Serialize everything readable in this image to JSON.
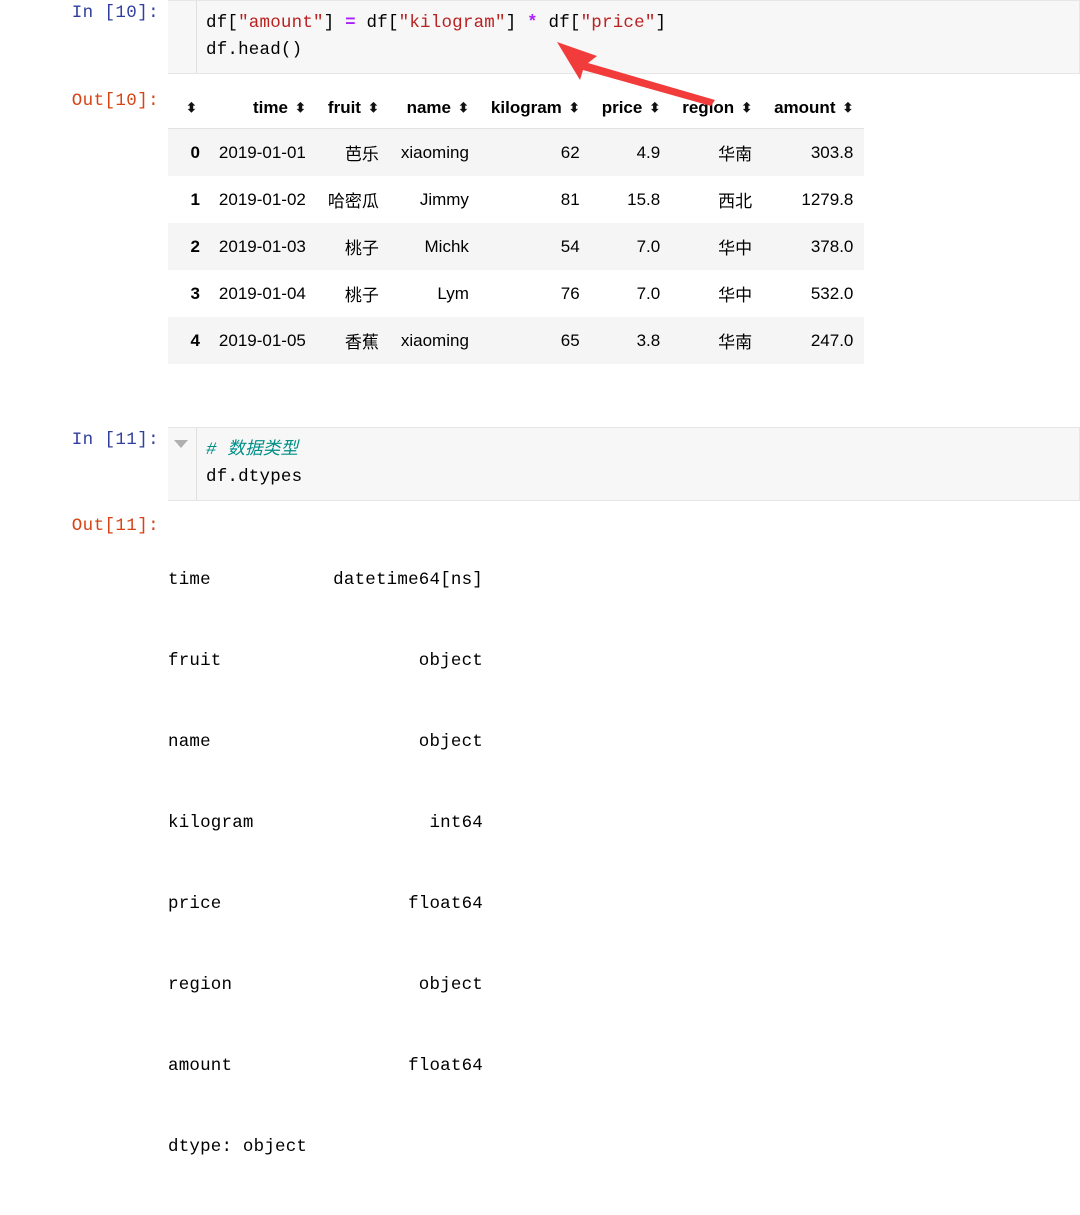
{
  "cells": [
    {
      "prompt": "In [10]:",
      "code_plain": "df[\"amount\"] = df[\"kilogram\"] * df[\"price\"]\ndf.head()",
      "code_tokens": {
        "l1_a": "df[",
        "l1_str1": "\"amount\"",
        "l1_b": "] ",
        "l1_eq": "=",
        "l1_c": " df[",
        "l1_str2": "\"kilogram\"",
        "l1_d": "] ",
        "l1_mul": "*",
        "l1_e": " df[",
        "l1_str3": "\"price\"",
        "l1_f": "]",
        "l2": "df.head()"
      }
    },
    {
      "prompt": "In [11]:",
      "comment": "# 数据类型",
      "code_line": "df.dtypes"
    }
  ],
  "outputs": {
    "table": {
      "prompt": "Out[10]:",
      "sort_icon": "⬍",
      "index_header": "",
      "columns": [
        "time",
        "fruit",
        "name",
        "kilogram",
        "price",
        "region",
        "amount"
      ],
      "rows": [
        {
          "index": "0",
          "time": "2019-01-01",
          "fruit": "芭乐",
          "name": "xiaoming",
          "kilogram": "62",
          "price": "4.9",
          "region": "华南",
          "amount": "303.8"
        },
        {
          "index": "1",
          "time": "2019-01-02",
          "fruit": "哈密瓜",
          "name": "Jimmy",
          "kilogram": "81",
          "price": "15.8",
          "region": "西北",
          "amount": "1279.8"
        },
        {
          "index": "2",
          "time": "2019-01-03",
          "fruit": "桃子",
          "name": "Michk",
          "kilogram": "54",
          "price": "7.0",
          "region": "华中",
          "amount": "378.0"
        },
        {
          "index": "3",
          "time": "2019-01-04",
          "fruit": "桃子",
          "name": "Lym",
          "kilogram": "76",
          "price": "7.0",
          "region": "华中",
          "amount": "532.0"
        },
        {
          "index": "4",
          "time": "2019-01-05",
          "fruit": "香蕉",
          "name": "xiaoming",
          "kilogram": "65",
          "price": "3.8",
          "region": "华南",
          "amount": "247.0"
        }
      ]
    },
    "dtypes": {
      "prompt": "Out[11]:",
      "entries": [
        {
          "name": "time",
          "dtype": "datetime64[ns]"
        },
        {
          "name": "fruit",
          "dtype": "object"
        },
        {
          "name": "name",
          "dtype": "object"
        },
        {
          "name": "kilogram",
          "dtype": "int64"
        },
        {
          "name": "price",
          "dtype": "float64"
        },
        {
          "name": "region",
          "dtype": "object"
        },
        {
          "name": "amount",
          "dtype": "float64"
        }
      ],
      "footer": "dtype: object"
    }
  },
  "annotation": {
    "arrow_color": "#F23B3B",
    "arrow_label": "red-pointer-arrow"
  }
}
